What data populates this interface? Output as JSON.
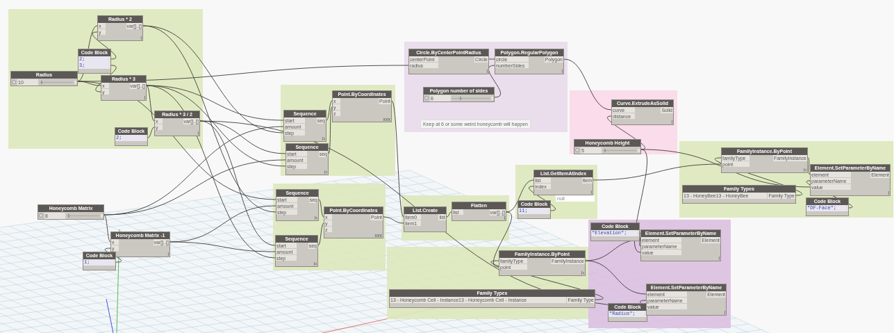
{
  "groups": [
    {
      "color": "#dde8bb"
    },
    {
      "color": "#dde8bb"
    },
    {
      "color": "#e8d9ea"
    },
    {
      "color": "#f9d8e8"
    },
    {
      "color": "#dde8bb"
    },
    {
      "color": "#dde8bb"
    },
    {
      "color": "#dde8bb"
    },
    {
      "color": "#dde8bb"
    },
    {
      "color": "#dac0e0"
    },
    {
      "color": "#dde8bb"
    }
  ],
  "note": {
    "text": "Keep at 6 or some weird honeycomb will happen"
  },
  "preview": {
    "text": "null"
  },
  "nodes": [
    {
      "kind": "slider",
      "title": "Radius",
      "value": "10",
      "level": 0.05
    },
    {
      "kind": "function",
      "title": "Radius * 2",
      "inputs": [
        "x",
        "y"
      ],
      "outputs": [
        "var[]..[]"
      ],
      "lacing": "l"
    },
    {
      "kind": "code",
      "title": "Code Block",
      "lines": [
        "2;",
        "3;"
      ]
    },
    {
      "kind": "function",
      "title": "Radius * 3",
      "inputs": [
        "x",
        "y"
      ],
      "outputs": [
        "var[]..[]"
      ],
      "lacing": "l"
    },
    {
      "kind": "function",
      "title": "Radius * 3 / 2",
      "inputs": [
        "x",
        "y"
      ],
      "outputs": [
        "var[]..[]"
      ],
      "lacing": "l"
    },
    {
      "kind": "code",
      "title": "Code Block",
      "lines": [
        "2;"
      ]
    },
    {
      "kind": "function",
      "title": "Sequence",
      "inputs": [
        "start",
        "amount",
        "step"
      ],
      "outputs": [
        "seq"
      ],
      "lacing": "l²"
    },
    {
      "kind": "function",
      "title": "Sequence",
      "inputs": [
        "start",
        "amount",
        "step"
      ],
      "outputs": [
        "seq"
      ],
      "lacing": "l²"
    },
    {
      "kind": "function",
      "title": "Point.ByCoordinates",
      "inputs": [
        "x",
        "y",
        "z"
      ],
      "outputs": [
        "Point"
      ],
      "lacing": "xxx"
    },
    {
      "kind": "function",
      "title": "Circle.ByCenterPointRadius",
      "inputs": [
        "centerPoint",
        "radius"
      ],
      "outputs": [
        "Circle"
      ],
      "lacing": "l"
    },
    {
      "kind": "slider",
      "title": "Polygon number of sides",
      "value": "6",
      "level": 0.2
    },
    {
      "kind": "function",
      "title": "Polygon.RegularPolygon",
      "inputs": [
        "circle",
        "numberSides"
      ],
      "outputs": [
        "Polygon"
      ],
      "lacing": "l"
    },
    {
      "kind": "function",
      "title": "Curve.ExtrudeAsSolid",
      "inputs": [
        "curve",
        "distance"
      ],
      "outputs": [
        "Solid"
      ],
      "lacing": "l"
    },
    {
      "kind": "slider",
      "title": "Honeycomb Height",
      "value": "5",
      "level": 0.05
    },
    {
      "kind": "function",
      "title": "FamilyInstance.ByPoint",
      "inputs": [
        "familyType",
        "point"
      ],
      "outputs": [
        "FamilyInstance"
      ],
      "lacing": "l²"
    },
    {
      "kind": "function",
      "title": "Element.SetParameterByName",
      "inputs": [
        "element",
        "parameterName",
        "value"
      ],
      "outputs": [
        "Element"
      ],
      "lacing": "l"
    },
    {
      "kind": "dropdown",
      "title": "Family Types",
      "value": "13 - HoneyBee13 - HoneyBee",
      "output": "Family Type"
    },
    {
      "kind": "code",
      "title": "Code Block",
      "lines": [
        "\"DF-Face\";"
      ]
    },
    {
      "kind": "slider",
      "title": "Honeycomb Matrix",
      "value": "8",
      "level": 0.05
    },
    {
      "kind": "function",
      "title": "Honeycomb Matrix -1",
      "inputs": [
        "x",
        "y"
      ],
      "outputs": [
        "var[]..[]"
      ],
      "lacing": "l"
    },
    {
      "kind": "code",
      "title": "Code Block",
      "lines": [
        "1;"
      ]
    },
    {
      "kind": "function",
      "title": "Sequence",
      "inputs": [
        "start",
        "amount",
        "step"
      ],
      "outputs": [
        "seq"
      ],
      "lacing": "l²"
    },
    {
      "kind": "function",
      "title": "Sequence",
      "inputs": [
        "start",
        "amount",
        "step"
      ],
      "outputs": [
        "seq"
      ],
      "lacing": "l²"
    },
    {
      "kind": "function",
      "title": "Point.ByCoordinates",
      "inputs": [
        "x",
        "y",
        "z"
      ],
      "outputs": [
        "Point"
      ],
      "lacing": "xxx"
    },
    {
      "kind": "function",
      "title": "List.Create",
      "inputs": [
        "item0",
        "item1"
      ],
      "outputs": [
        "list"
      ]
    },
    {
      "kind": "function",
      "title": "Flatten",
      "inputs": [
        "list"
      ],
      "outputs": [
        "var[]..[]"
      ],
      "lacing": "l"
    },
    {
      "kind": "function",
      "title": "List.GetItemAtIndex",
      "inputs": [
        "list",
        "index"
      ],
      "outputs": [
        "item"
      ],
      "lacing": "l"
    },
    {
      "kind": "code",
      "title": "Code Block",
      "lines": [
        "11;"
      ]
    },
    {
      "kind": "code",
      "title": "Code Block",
      "lines": [
        "\"Elevation\";"
      ]
    },
    {
      "kind": "function",
      "title": "Element.SetParameterByName",
      "inputs": [
        "element",
        "parameterName",
        "value"
      ],
      "outputs": [
        "Element"
      ],
      "lacing": "l"
    },
    {
      "kind": "function",
      "title": "FamilyInstance.ByPoint",
      "inputs": [
        "familyType",
        "point"
      ],
      "outputs": [
        "FamilyInstance"
      ],
      "lacing": "l²"
    },
    {
      "kind": "dropdown",
      "title": "Family Types",
      "value": "13 - Honeycomb Cell - Instance13 - Honeycomb Cell - Instance",
      "output": "Family Type"
    },
    {
      "kind": "code",
      "title": "Code Block",
      "lines": [
        "\"Radius\";"
      ]
    },
    {
      "kind": "function",
      "title": "Element.SetParameterByName",
      "inputs": [
        "element",
        "parameterName",
        "value"
      ],
      "outputs": [
        "Element"
      ],
      "lacing": "l"
    }
  ]
}
